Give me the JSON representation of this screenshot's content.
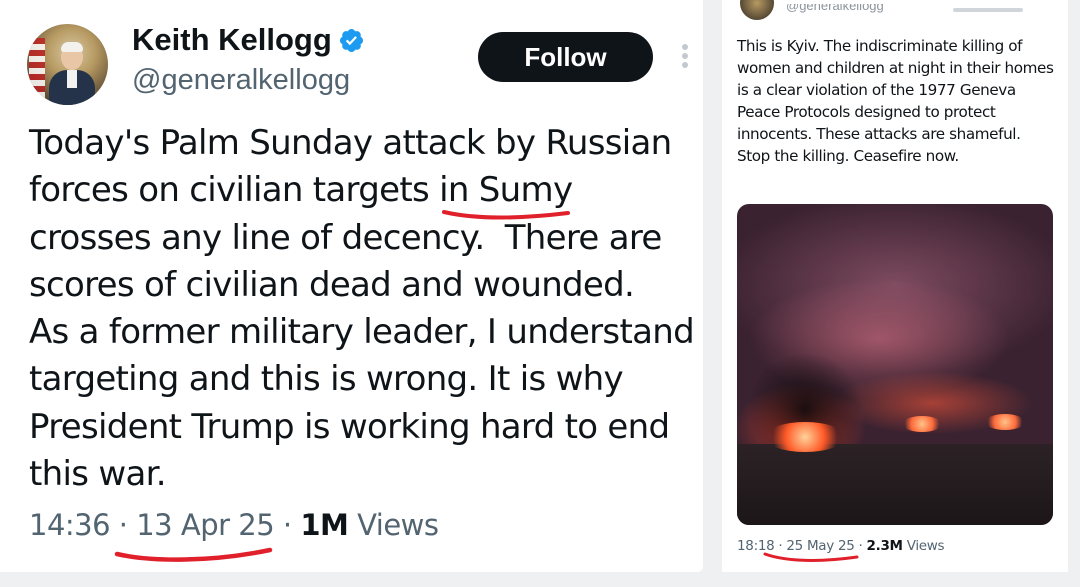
{
  "left_tweet": {
    "display_name": "Keith Kellogg",
    "handle": "@generalkellogg",
    "follow_label": "Follow",
    "text": "Today's Palm Sunday attack by Russian\nforces on civilian targets in Sumy\ncrosses any line of decency.  There are\nscores of civilian dead and wounded.\nAs a former military leader, I understand\ntargeting and this is wrong. It is why\nPresident Trump is working hard to end\nthis war.",
    "time": "14:36",
    "date": "13 Apr 25",
    "views_count": "1M",
    "views_label": "Views",
    "icons": [
      "verified-badge-icon",
      "more-options-icon"
    ]
  },
  "right_tweet": {
    "handle": "@generalkellogg",
    "text": "This is Kyiv. The indiscriminate killing of women and children at night in their homes is a clear violation of the 1977 Geneva Peace Protocols designed to protect innocents. These attacks are shameful. Stop the killing. Ceasefire now.",
    "time": "18:18",
    "date": "25 May 25",
    "views_count": "2.3M",
    "views_label": "Views"
  },
  "colors": {
    "text": "#0f1419",
    "secondary": "#536471",
    "verified": "#1d9bf0",
    "annotation_underline": "#e0202a"
  }
}
